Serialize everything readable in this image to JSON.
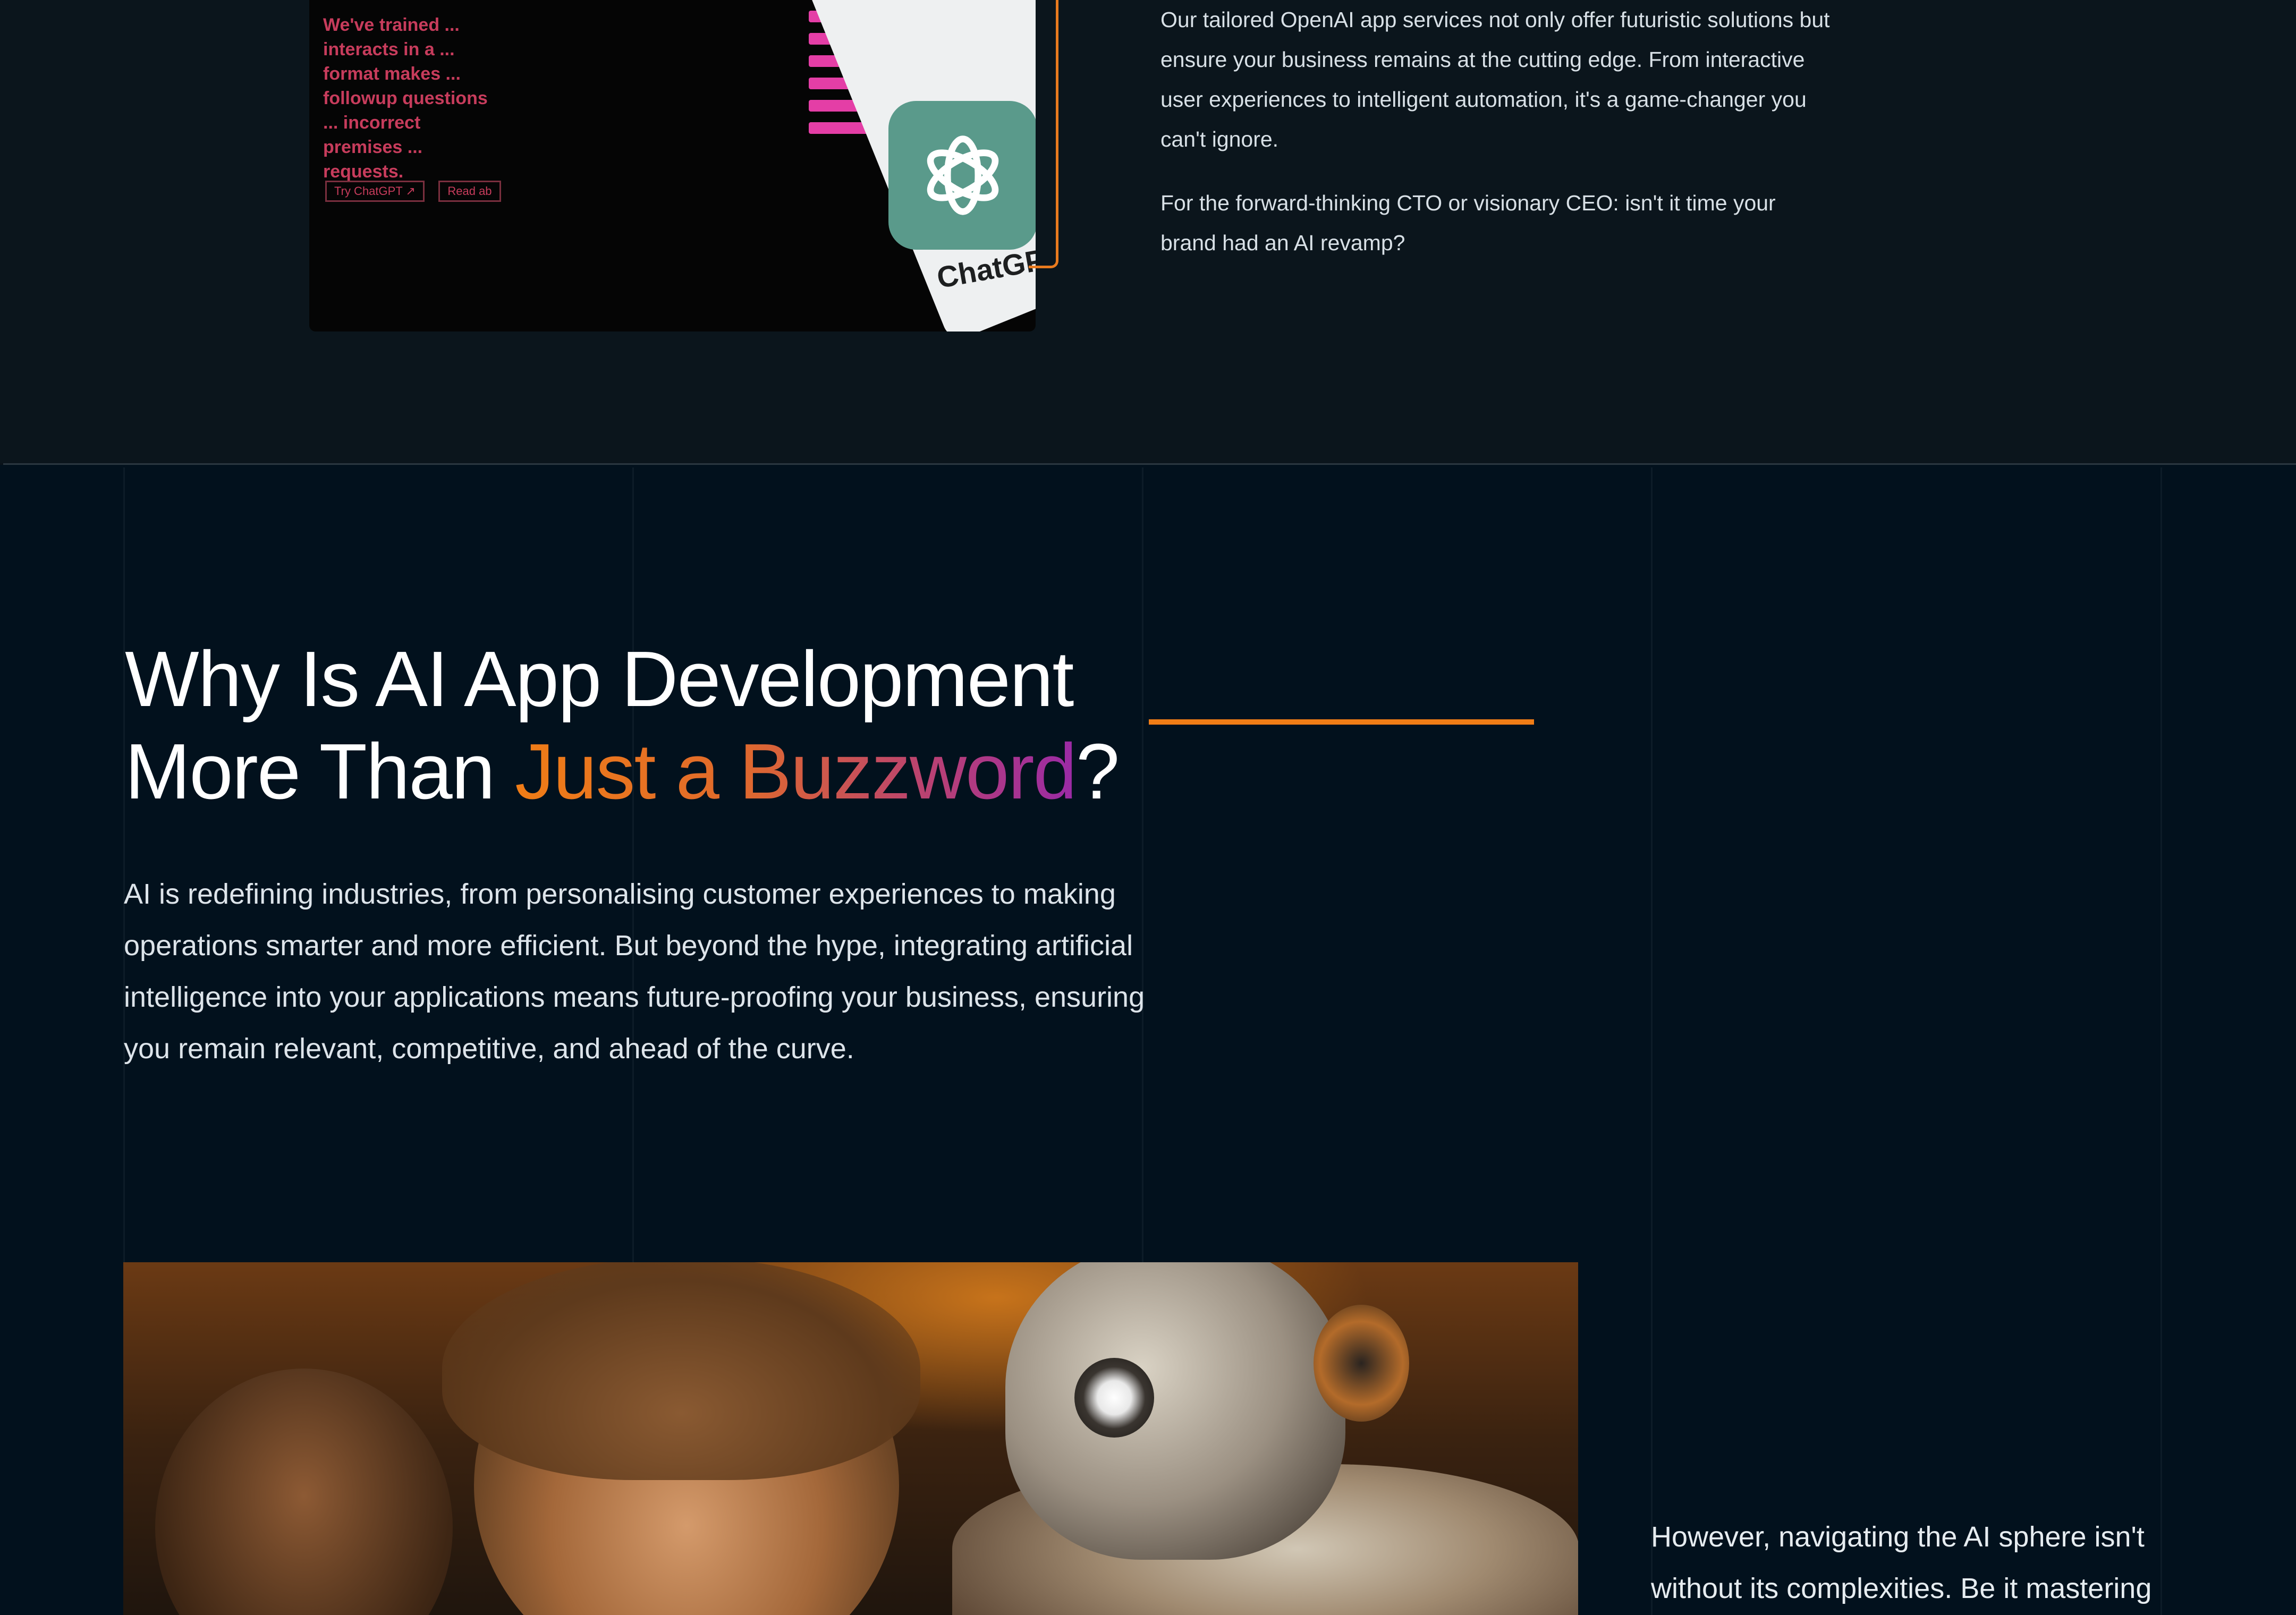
{
  "top_section": {
    "paragraphs": [
      "Our tailored OpenAI app services not only offer futuristic solutions but ensure your business remains at the cutting edge. From interactive user experiences to intelligent automation, it's a game-changer you can't ignore.",
      "For the forward-thinking CTO or visionary CEO: isn't it time your brand had an AI revamp?"
    ],
    "image": {
      "screen_text": "We've trained ... interacts in a ... format makes ... followup questions ... incorrect premises ... requests.",
      "screen_buttons": [
        "Try ChatGPT ↗",
        "Read ab"
      ],
      "phone_label": "ChatGPT",
      "logo_icon": "openai-knot-icon"
    }
  },
  "main_section": {
    "heading": {
      "line1": "Why Is AI App Development",
      "line2_plain": "More Than ",
      "line2_highlight": "Just a Buzzword",
      "line2_end": "?"
    },
    "body": "AI is redefining industries, from personalising customer experiences to making operations smarter and more efficient. But beyond the hype, integrating artificial intelligence into your applications means future-proofing your business, ensuring you remain relevant, competitive, and ahead of the curve.",
    "side_text": "However, navigating the AI sphere isn't without its complexities. Be it mastering"
  },
  "colors": {
    "accent_orange": "#f07d16",
    "gradient_end": "#9a2aa6",
    "background": "#02111d"
  }
}
